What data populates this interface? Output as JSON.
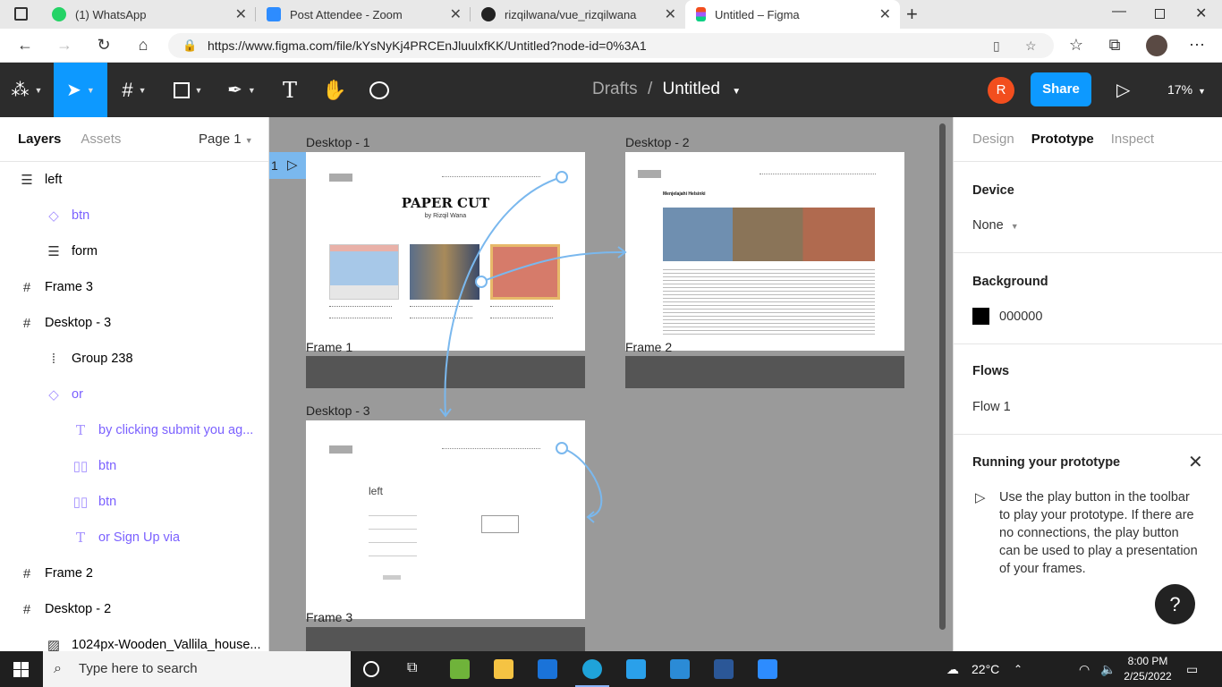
{
  "browser": {
    "tabs": [
      {
        "title": "(1) WhatsApp",
        "color": "#25d366"
      },
      {
        "title": "Post Attendee - Zoom",
        "color": "#2d8cff"
      },
      {
        "title": "rizqilwana/vue_rizqilwana",
        "color": "#222222"
      },
      {
        "title": "Untitled – Figma",
        "color": "#f24e1e",
        "active": true
      }
    ],
    "url": "https://www.figma.com/file/kYsNyKj4PRCEnJluulxfKK/Untitled?node-id=0%3A1"
  },
  "toolbar": {
    "breadcrumb_parent": "Drafts",
    "breadcrumb_sep": "/",
    "file_name": "Untitled",
    "avatar_initial": "R",
    "share_label": "Share",
    "zoom_label": "17%",
    "accent_color": "#0d99ff"
  },
  "left_panel": {
    "tab_layers": "Layers",
    "tab_assets": "Assets",
    "page_label": "Page 1",
    "layers": [
      {
        "name": "left",
        "icon": "list-icon",
        "depth": 0
      },
      {
        "name": "btn",
        "icon": "component-icon",
        "depth": 1,
        "component": true
      },
      {
        "name": "form",
        "icon": "list-icon",
        "depth": 1
      },
      {
        "name": "Frame 3",
        "icon": "frame-icon",
        "depth": 0
      },
      {
        "name": "Desktop - 3",
        "icon": "frame-icon",
        "depth": 0
      },
      {
        "name": "Group 238",
        "icon": "group-icon",
        "depth": 1
      },
      {
        "name": "or",
        "icon": "component-icon",
        "depth": 1,
        "component": true
      },
      {
        "name": "by clicking submit you ag...",
        "icon": "text-icon",
        "depth": 2,
        "component": true
      },
      {
        "name": "btn",
        "icon": "instance-icon",
        "depth": 2,
        "component": true
      },
      {
        "name": "btn",
        "icon": "instance-icon",
        "depth": 2,
        "component": true
      },
      {
        "name": "or Sign Up via",
        "icon": "text-icon",
        "depth": 2,
        "component": true
      },
      {
        "name": "Frame 2",
        "icon": "frame-icon",
        "depth": 0
      },
      {
        "name": "Desktop - 2",
        "icon": "frame-icon",
        "depth": 0
      },
      {
        "name": "1024px-Wooden_Vallila_house...",
        "icon": "image-icon",
        "depth": 1
      }
    ]
  },
  "canvas": {
    "flow_number": "1",
    "frames": [
      {
        "label": "Desktop - 1",
        "title": "PAPER CUT",
        "subtitle": "by Rizqil Wana"
      },
      {
        "label": "Desktop - 2",
        "title": "Menjelajahi Helsinki"
      },
      {
        "label": "Desktop - 3",
        "title": "left"
      },
      {
        "label": "Frame 1"
      },
      {
        "label": "Frame 2"
      },
      {
        "label": "Frame 3"
      }
    ],
    "frame_accent": "#7ab8ee"
  },
  "right_panel": {
    "tab_design": "Design",
    "tab_prototype": "Prototype",
    "tab_inspect": "Inspect",
    "device_heading": "Device",
    "device_value": "None",
    "background_heading": "Background",
    "background_value": "000000",
    "background_color": "#000000",
    "flows_heading": "Flows",
    "flow_name": "Flow 1",
    "running_heading": "Running your prototype",
    "running_text": "Use the play button in the toolbar to play your prototype. If there are no connections, the play button can be used to play a presentation of your frames."
  },
  "taskbar": {
    "search_placeholder": "Type here to search",
    "weather": "22°C",
    "time": "8:00 PM",
    "date": "2/25/2022"
  }
}
